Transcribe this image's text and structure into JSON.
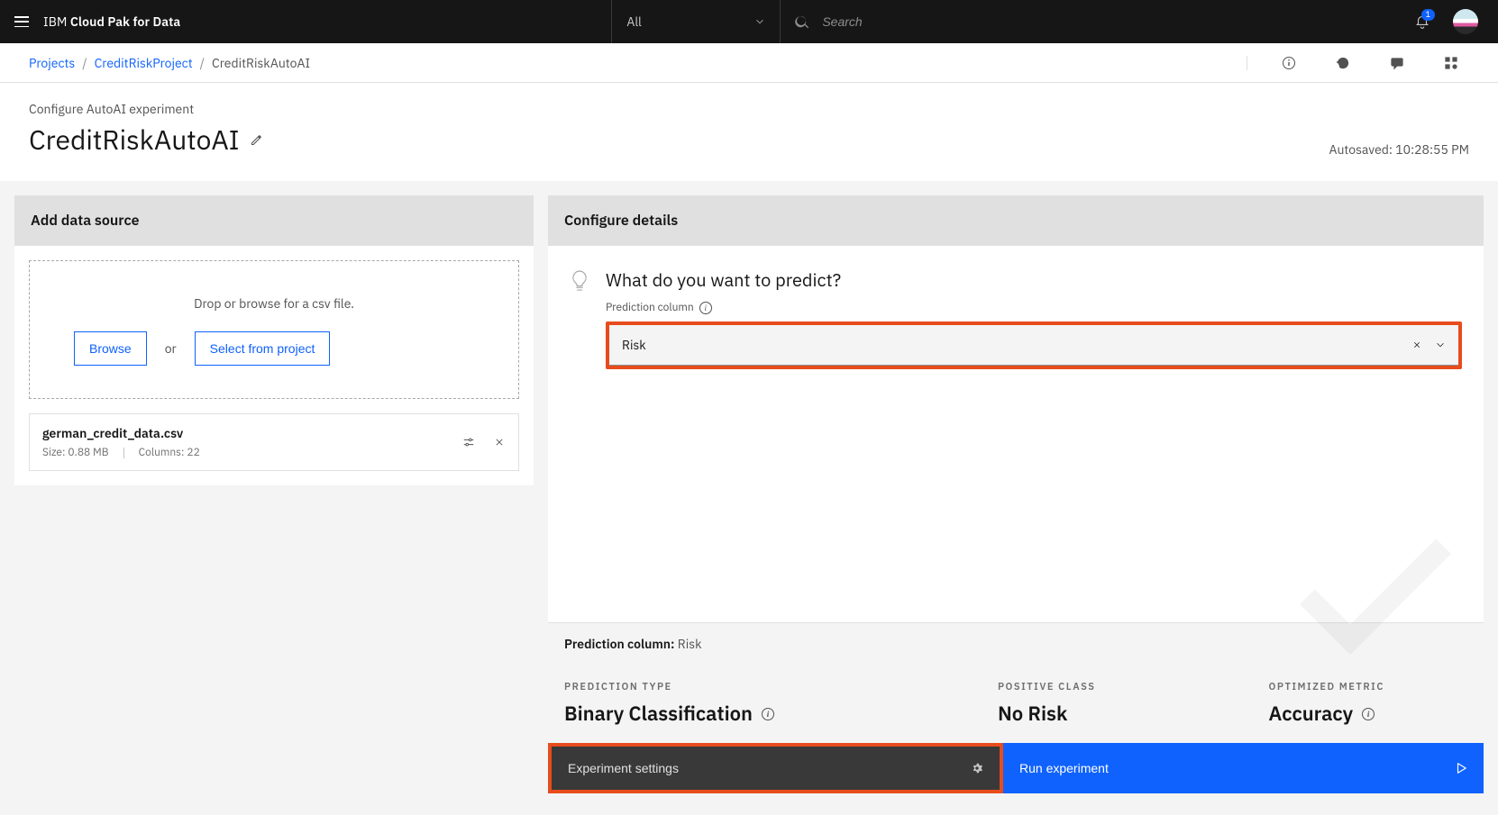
{
  "topbar": {
    "brand_ibm": "IBM",
    "brand_cpd": "Cloud Pak for Data",
    "scope_selector": "All",
    "search_placeholder": "Search",
    "notification_count": "1"
  },
  "breadcrumbs": {
    "items": [
      "Projects",
      "CreditRiskProject"
    ],
    "current": "CreditRiskAutoAI"
  },
  "title": {
    "label": "Configure AutoAI experiment",
    "main": "CreditRiskAutoAI",
    "autosave": "Autosaved: 10:28:55 PM"
  },
  "left_panel": {
    "header": "Add data source",
    "drop_text": "Drop or browse for a csv file.",
    "browse_label": "Browse",
    "or_text": "or",
    "select_label": "Select from project",
    "file": {
      "name": "german_credit_data.csv",
      "size_label": "Size:",
      "size_value": "0.88 MB",
      "cols_label": "Columns:",
      "cols_value": "22"
    }
  },
  "right_panel": {
    "header": "Configure details",
    "question": "What do you want to predict?",
    "column_label": "Prediction column",
    "selected_column": "Risk",
    "summary_label": "Prediction column:",
    "summary_value": "Risk",
    "info": {
      "pred_type_h": "PREDICTION TYPE",
      "pred_type_v": "Binary Classification",
      "pos_class_h": "POSITIVE CLASS",
      "pos_class_v": "No Risk",
      "metric_h": "OPTIMIZED METRIC",
      "metric_v": "Accuracy"
    },
    "settings_btn": "Experiment settings",
    "run_btn": "Run experiment"
  }
}
